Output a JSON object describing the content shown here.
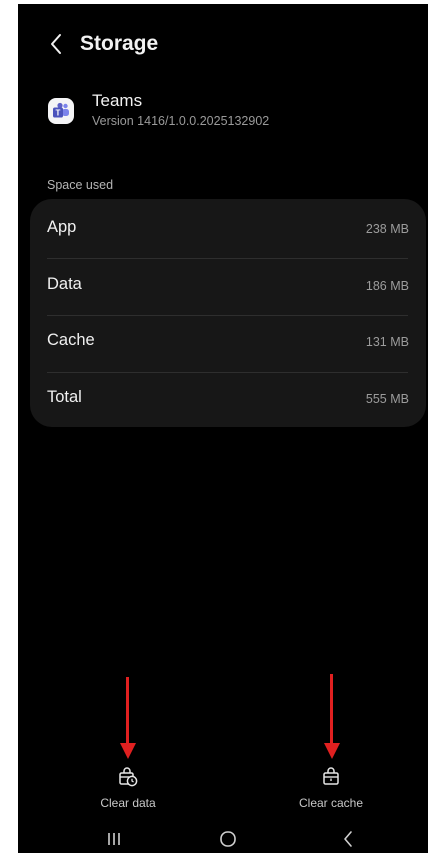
{
  "header": {
    "title": "Storage"
  },
  "app": {
    "name": "Teams",
    "version": "Version 1416/1.0.0.2025132902"
  },
  "storage": {
    "section_label": "Space used",
    "rows": [
      {
        "label": "App",
        "value": "238 MB"
      },
      {
        "label": "Data",
        "value": "186 MB"
      },
      {
        "label": "Cache",
        "value": "131 MB"
      },
      {
        "label": "Total",
        "value": "555 MB"
      }
    ]
  },
  "actions": {
    "clear_data": "Clear data",
    "clear_cache": "Clear cache"
  },
  "icons": {
    "back": "chevron-left-icon",
    "app": "teams-app-icon",
    "clear_data": "bag-clock-icon",
    "clear_cache": "bag-icon",
    "nav_recents": "recents-icon",
    "nav_home": "home-icon",
    "nav_back": "back-icon"
  },
  "colors": {
    "annotation_arrow": "#e02020",
    "card_background": "#171717",
    "teams_purple": "#5b5fc7"
  }
}
